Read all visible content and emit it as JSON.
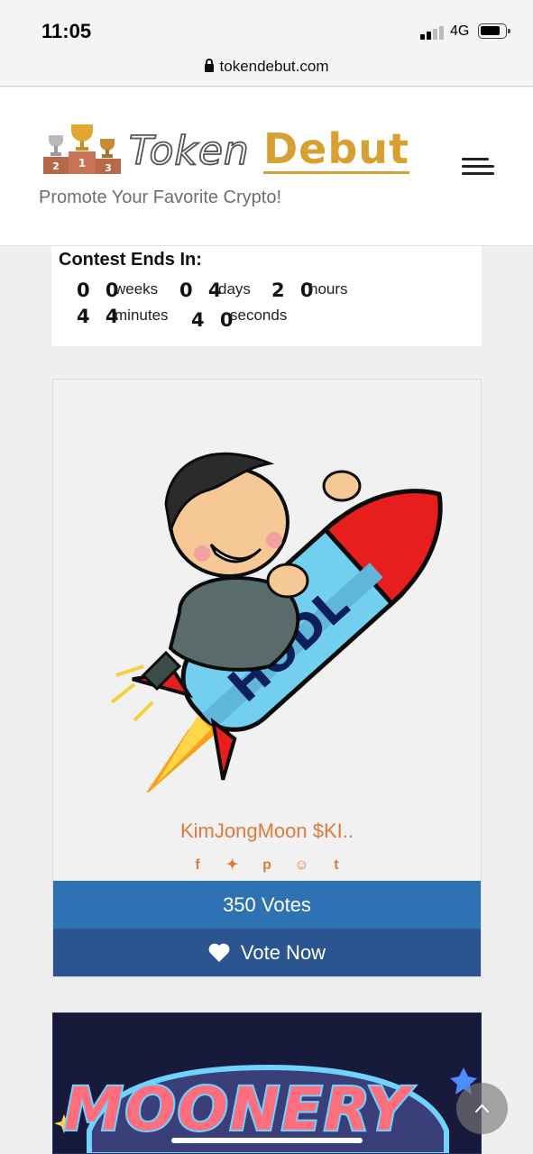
{
  "status_bar": {
    "time": "11:05",
    "network": "4G"
  },
  "browser": {
    "url": "tokendebut.com"
  },
  "header": {
    "logo_part1": "Token",
    "logo_part2": "Debut",
    "tagline": "Promote Your Favorite Crypto!",
    "podium_labels": [
      "2",
      "1",
      "3"
    ]
  },
  "countdown": {
    "title": "Contest Ends In:",
    "weeks": "0 0",
    "weeks_label": "weeks",
    "days": "0 4",
    "days_label": "days",
    "hours": "2 0",
    "hours_label": "hours",
    "minutes": "4 4",
    "minutes_label": "minutes",
    "seconds": "4 0",
    "seconds_label": "seconds"
  },
  "card": {
    "image_text": "HODL",
    "name": "KimJongMoon $KI..",
    "social_icons": [
      "facebook-icon",
      "twitter-icon",
      "pinterest-icon",
      "reddit-icon",
      "tumblr-icon"
    ],
    "social_glyphs": [
      "f",
      "✦",
      "p",
      "☺",
      "t"
    ],
    "votes": "350 Votes",
    "vote_button": "Vote Now"
  },
  "card2": {
    "title": "MOONERY"
  },
  "colors": {
    "accent_orange": "#e07a3a",
    "votes_blue": "#2e72b4",
    "vote_button_blue": "#2a5590",
    "logo_gold": "#d7a132"
  }
}
